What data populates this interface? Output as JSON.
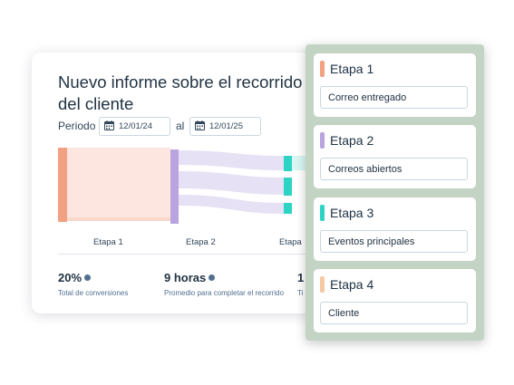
{
  "report": {
    "title": "Nuevo informe sobre el recorrido del cliente",
    "period_label": "Periodo",
    "date_from": "12/01/24",
    "between_label": "al",
    "date_to": "12/01/25",
    "calendar_icon": "calendar-icon",
    "chart_stage_labels": [
      "Etapa 1",
      "Etapa 2",
      "Etapa"
    ],
    "metrics": [
      {
        "value": "20%",
        "label": "Total de conversiones"
      },
      {
        "value": "9 horas",
        "label": "Promedio para completar el recorrido"
      },
      {
        "value": "1",
        "label": "Ti"
      }
    ],
    "colors": {
      "etapa1": "#f2a183",
      "etapa2": "#b9a4e0",
      "etapa3": "#2dd4c6",
      "etapa4": "#f5c9a3",
      "panel_bg": "#c3d4c4"
    }
  },
  "stages_panel": {
    "stages": [
      {
        "title": "Etapa 1",
        "value": "Correo entregado",
        "color": "#f2a183"
      },
      {
        "title": "Etapa 2",
        "value": "Correos abiertos",
        "color": "#b9a4e0"
      },
      {
        "title": "Etapa 3",
        "value": "Eventos principales",
        "color": "#2dd4c6"
      },
      {
        "title": "Etapa 4",
        "value": "Cliente",
        "color": "#f5c9a3"
      }
    ]
  }
}
